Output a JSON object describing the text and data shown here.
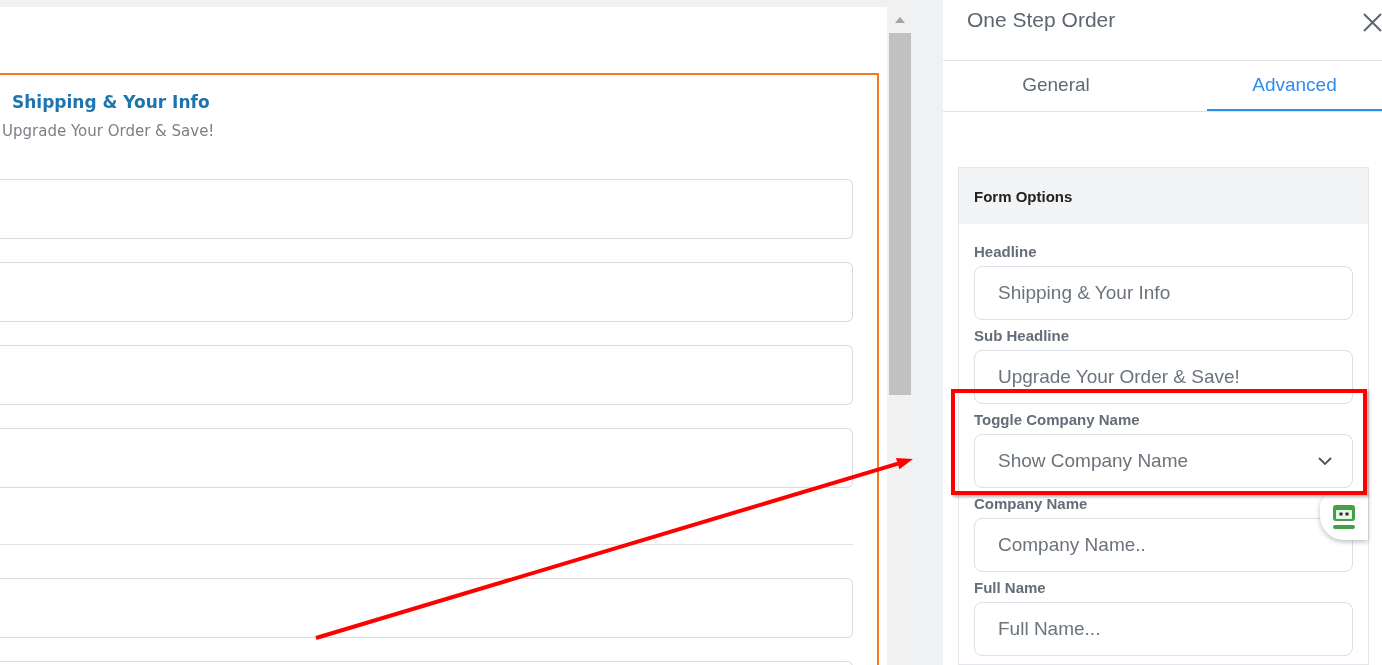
{
  "preview": {
    "headline": "Shipping & Your Info",
    "sub_headline": "Upgrade Your Order & Save!",
    "rows": [
      {
        "kind": "field"
      },
      {
        "kind": "field"
      },
      {
        "kind": "field"
      },
      {
        "kind": "field"
      },
      {
        "kind": "divider"
      },
      {
        "kind": "field"
      },
      {
        "kind": "field"
      }
    ]
  },
  "panel": {
    "title": "One Step Order",
    "tabs": [
      {
        "label": "General",
        "selected": false
      },
      {
        "label": "Advanced",
        "selected": true
      }
    ],
    "section": {
      "title": "Form Options",
      "fields": [
        {
          "label": "Headline",
          "kind": "text",
          "value": "Shipping & Your Info"
        },
        {
          "label": "Sub Headline",
          "kind": "text",
          "value": "Upgrade Your Order & Save!"
        },
        {
          "label": "Toggle Company Name",
          "kind": "select",
          "value": "Show Company Name"
        },
        {
          "label": "Company Name",
          "kind": "text",
          "value": "Company Name.."
        },
        {
          "label": "Full Name",
          "kind": "text",
          "value": "Full Name..."
        }
      ]
    }
  }
}
